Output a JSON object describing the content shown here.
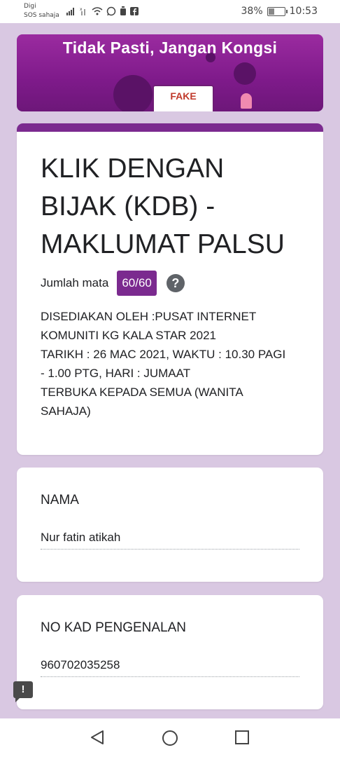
{
  "status": {
    "carrier_line1": "Digi",
    "carrier_line2": "SOS sahaja",
    "battery": "38%",
    "battery_level": 0.38,
    "time": "10:53"
  },
  "banner": {
    "title": "Tidak Pasti, Jangan Kongsi",
    "card_text": "FAKE"
  },
  "form": {
    "title": "KLIK DENGAN BIJAK (KDB) - MAKLUMAT PALSU",
    "score_label": "Jumlah mata",
    "score_value": "60/60",
    "help_glyph": "?",
    "description": "DISEDIAKAN OLEH :PUSAT INTERNET KOMUNITI KG KALA STAR 2021\nTARIKH : 26 MAC 2021, WAKTU : 10.30 PAGI - 1.00 PTG, HARI : JUMAAT\nTERBUKA KEPADA SEMUA  (WANITA SAHAJA)"
  },
  "questions": [
    {
      "label": "NAMA",
      "answer": "Nur fatin atikah"
    },
    {
      "label": "NO KAD PENGENALAN",
      "answer": "960702035258"
    }
  ],
  "report_glyph": "!",
  "colors": {
    "accent": "#7b2a8f",
    "background": "#d9c8e2",
    "banner": "#8e2398"
  },
  "nav": {
    "back_icon": "triangle-back-icon",
    "home_icon": "circle-home-icon",
    "recent_icon": "square-recent-icon"
  }
}
